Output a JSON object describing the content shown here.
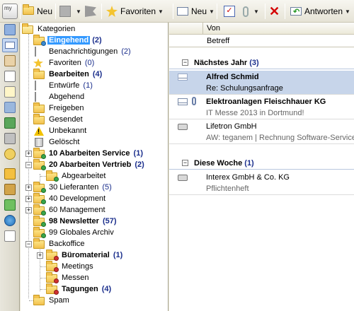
{
  "toolbar": {
    "logo": "my",
    "new_label": "Neu",
    "favorites_label": "Favoriten",
    "new_mail_label": "Neu",
    "reply_label": "Antworten"
  },
  "colors": {
    "accent": "#3399ff",
    "selection_row": "#c7d5ea",
    "count": "#1a2e8c",
    "folder": "#f2c14e",
    "warning": "#f2c200"
  },
  "tree": {
    "root": "Kategorien",
    "items": [
      {
        "label": "Eingehend",
        "count": "(2)",
        "icon": "inbox-icon"
      },
      {
        "label": "Benachrichtigungen",
        "count": "(2)",
        "icon": "bell-icon"
      },
      {
        "label": "Favoriten",
        "count": "(0)",
        "icon": "star-icon"
      },
      {
        "label": "Bearbeiten",
        "count": "(4)",
        "icon": "edit-icon"
      },
      {
        "label": "Entwürfe",
        "count": "(1)",
        "icon": "draft-icon"
      },
      {
        "label": "Abgehend",
        "count": "",
        "icon": "outbox-icon"
      },
      {
        "label": "Freigeben",
        "count": "",
        "icon": "approve-icon"
      },
      {
        "label": "Gesendet",
        "count": "",
        "icon": "sent-icon"
      },
      {
        "label": "Unbekannt",
        "count": "",
        "icon": "warning-icon"
      },
      {
        "label": "Gelöscht",
        "count": "",
        "icon": "trash-icon"
      },
      {
        "label": "10 Abarbeiten Service",
        "count": "(1)",
        "icon": "folder-icon"
      },
      {
        "label": "20 Abarbeiten Vertrieb",
        "count": "(2)",
        "icon": "folder-icon"
      },
      {
        "label": "Abgearbeitet",
        "count": "",
        "icon": "folder-icon"
      },
      {
        "label": "30 Lieferanten",
        "count": "(5)",
        "icon": "folder-icon"
      },
      {
        "label": "40 Development",
        "count": "",
        "icon": "folder-icon"
      },
      {
        "label": "60 Management",
        "count": "",
        "icon": "folder-icon"
      },
      {
        "label": "98 Newsletter",
        "count": "(57)",
        "icon": "folder-icon"
      },
      {
        "label": "99 Globales Archiv",
        "count": "",
        "icon": "folder-icon"
      },
      {
        "label": "Backoffice",
        "count": "",
        "icon": "folder-icon"
      },
      {
        "label": "Büromaterial",
        "count": "(1)",
        "icon": "folder-icon"
      },
      {
        "label": "Meetings",
        "count": "",
        "icon": "folder-icon"
      },
      {
        "label": "Messen",
        "count": "",
        "icon": "folder-icon"
      },
      {
        "label": "Tagungen",
        "count": "(4)",
        "icon": "folder-icon"
      },
      {
        "label": "Spam",
        "count": "",
        "icon": "folder-icon"
      }
    ]
  },
  "mail": {
    "col_from": "Von",
    "col_subject": "Betreff",
    "groups": [
      {
        "title": "Nächstes Jahr",
        "count": "(3)"
      },
      {
        "title": "Diese Woche",
        "count": "(1)"
      }
    ],
    "messages": [
      {
        "from": "Alfred Schmid",
        "subject": "Re: Schulungsanfrage"
      },
      {
        "from": "Elektroanlagen Fleischhauer KG",
        "subject": "IT Messe 2013 in Dortmund!"
      },
      {
        "from": "Lifetron GmbH",
        "subject": "AW: teganem | Rechnung Software-Service"
      },
      {
        "from": "Interex GmbH & Co. KG",
        "subject": "Pflichtenheft"
      }
    ]
  }
}
